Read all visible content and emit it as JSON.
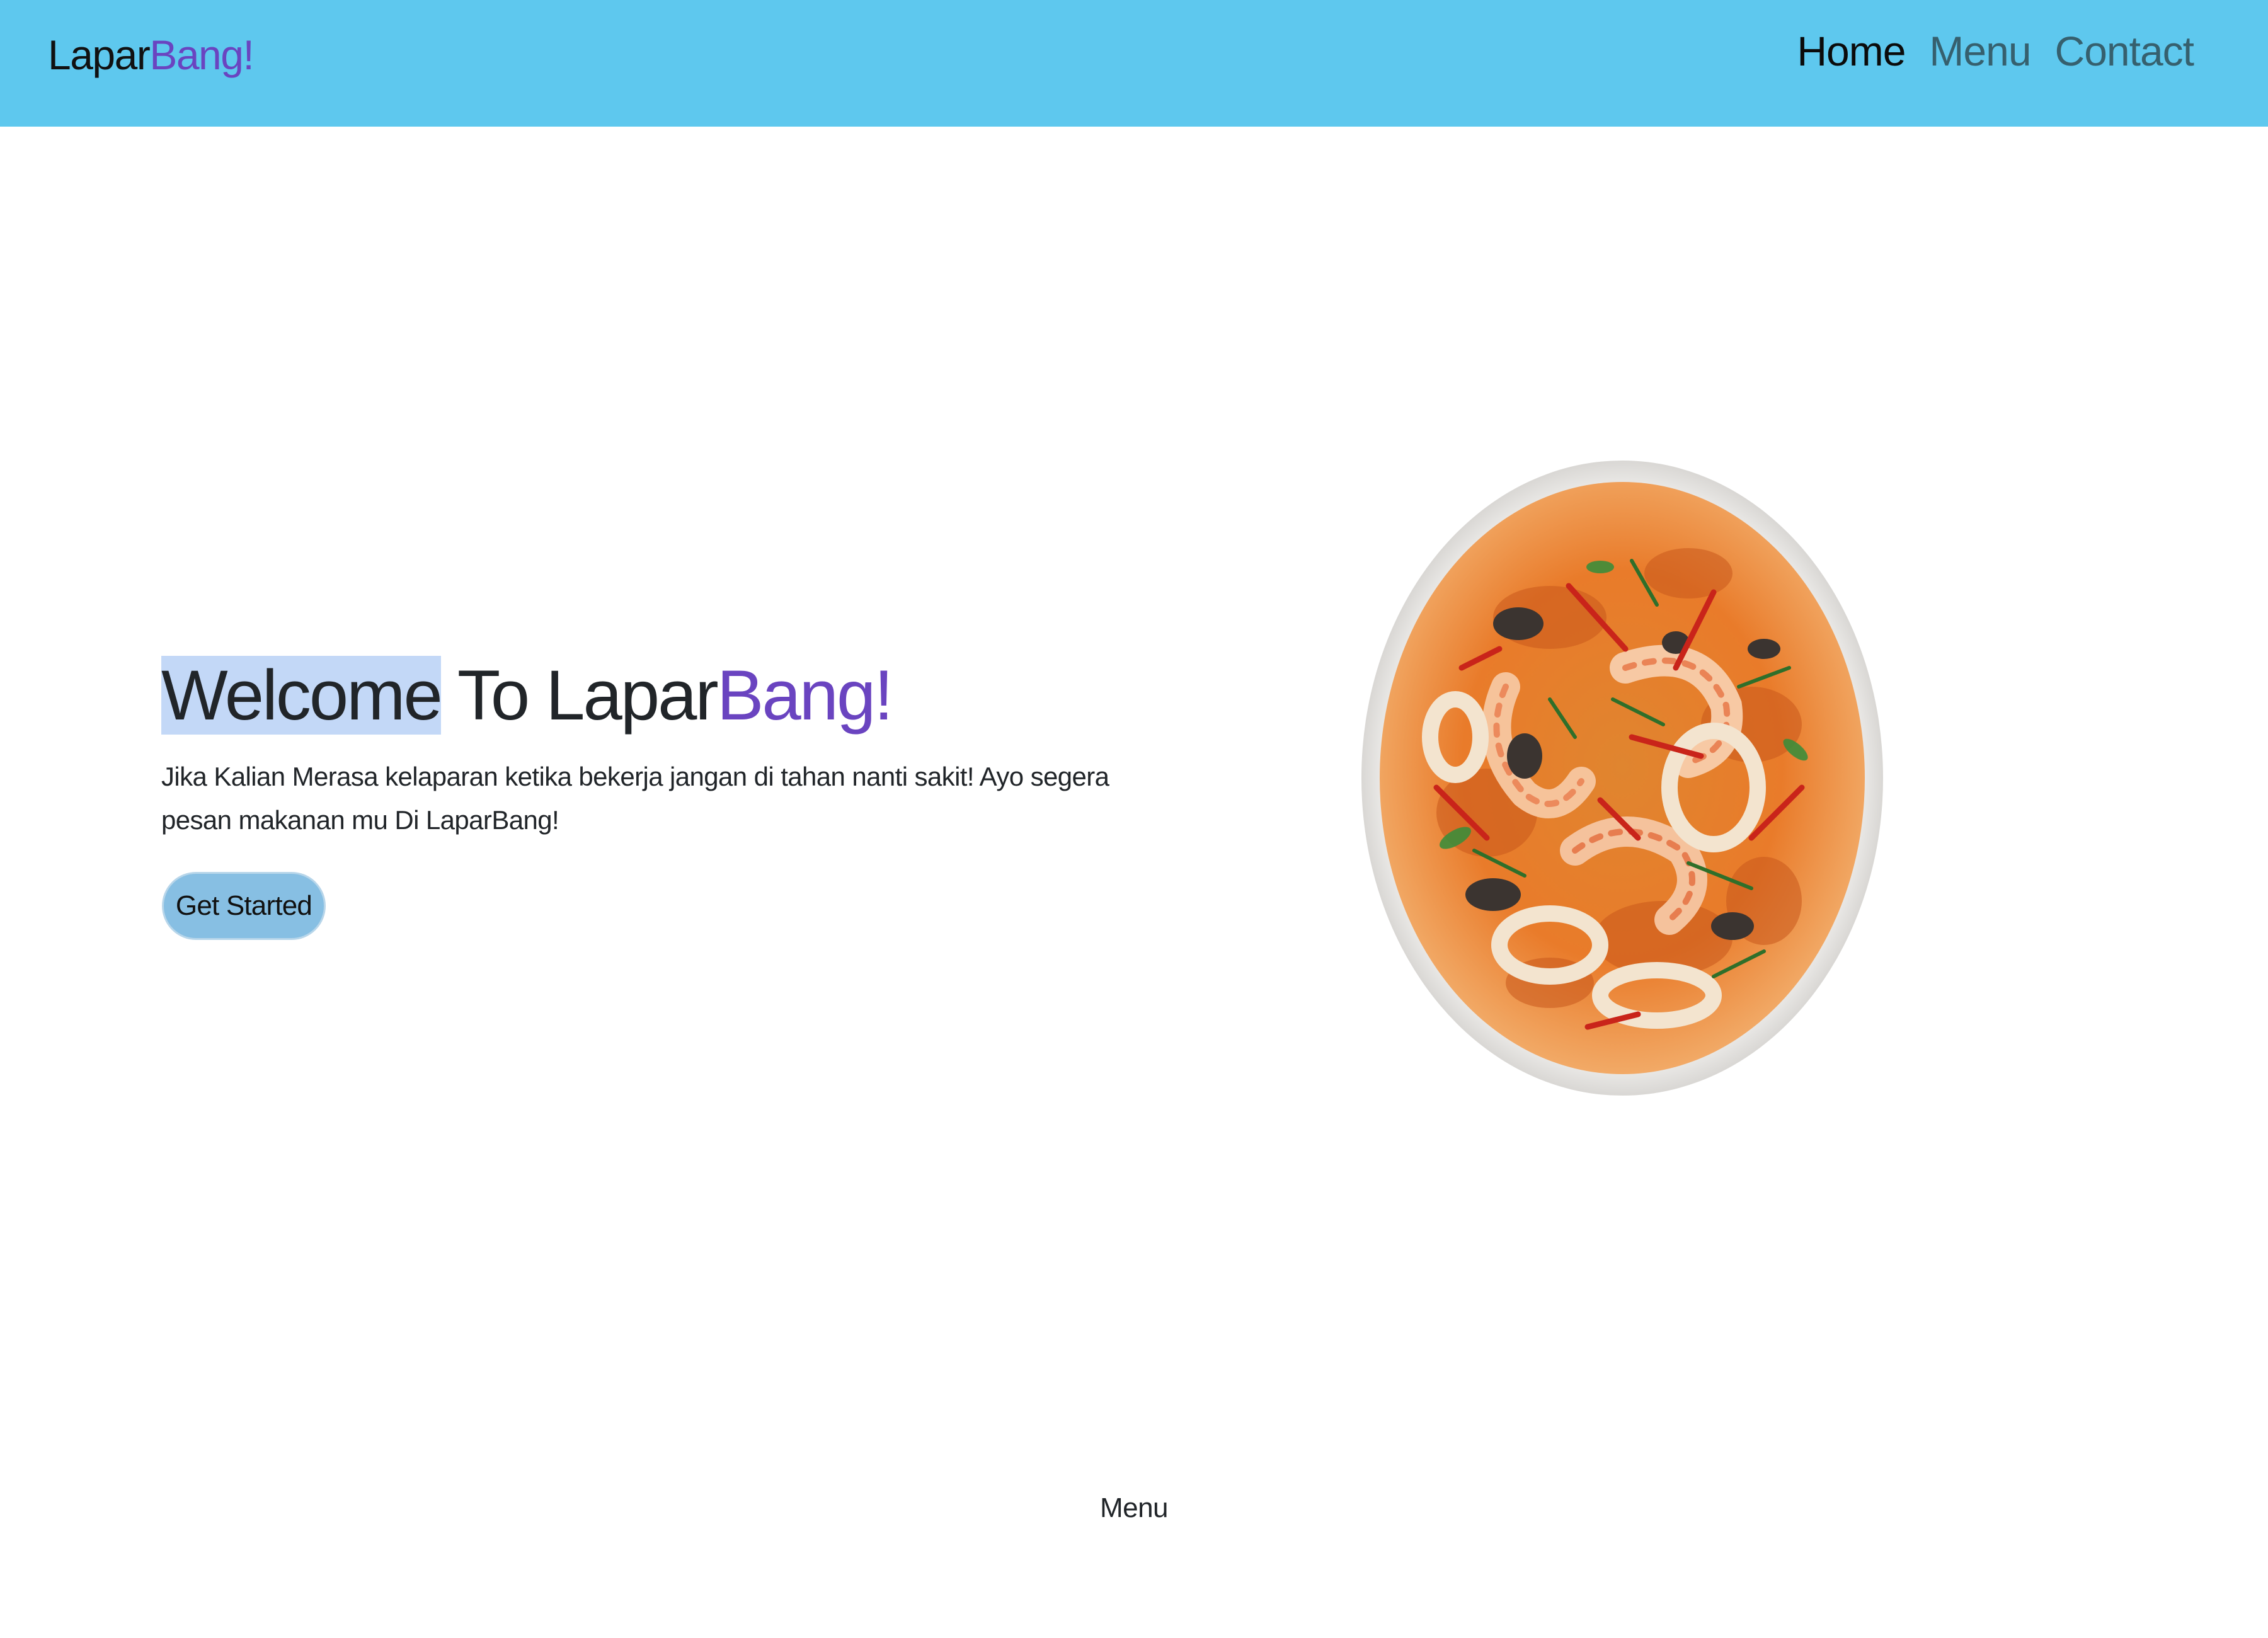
{
  "colors": {
    "navbar_bg": "#5ec8ee",
    "brand_accent": "#6a44c0",
    "nav_link": "#36606e",
    "nav_link_active": "#0b0b0b",
    "button_bg": "#87bfe3",
    "selection_highlight": "#c3d8f7"
  },
  "navbar": {
    "brand_main": "Lapar",
    "brand_accent": "Bang!",
    "links": [
      {
        "label": "Home",
        "active": true
      },
      {
        "label": "Menu",
        "active": false
      },
      {
        "label": "Contact",
        "active": false
      }
    ]
  },
  "hero": {
    "title_highlighted": "Welcome",
    "title_middle": " To Lapar",
    "title_accent": "Bang!",
    "description": "Jika Kalian Merasa kelaparan ketika bekerja jangan di tahan nanti sakit! Ayo segera pesan makanan mu Di LaparBang!",
    "button_label": "Get Started",
    "image_icon": "seafood-curry-bowl-image"
  },
  "section": {
    "label": "Menu"
  }
}
